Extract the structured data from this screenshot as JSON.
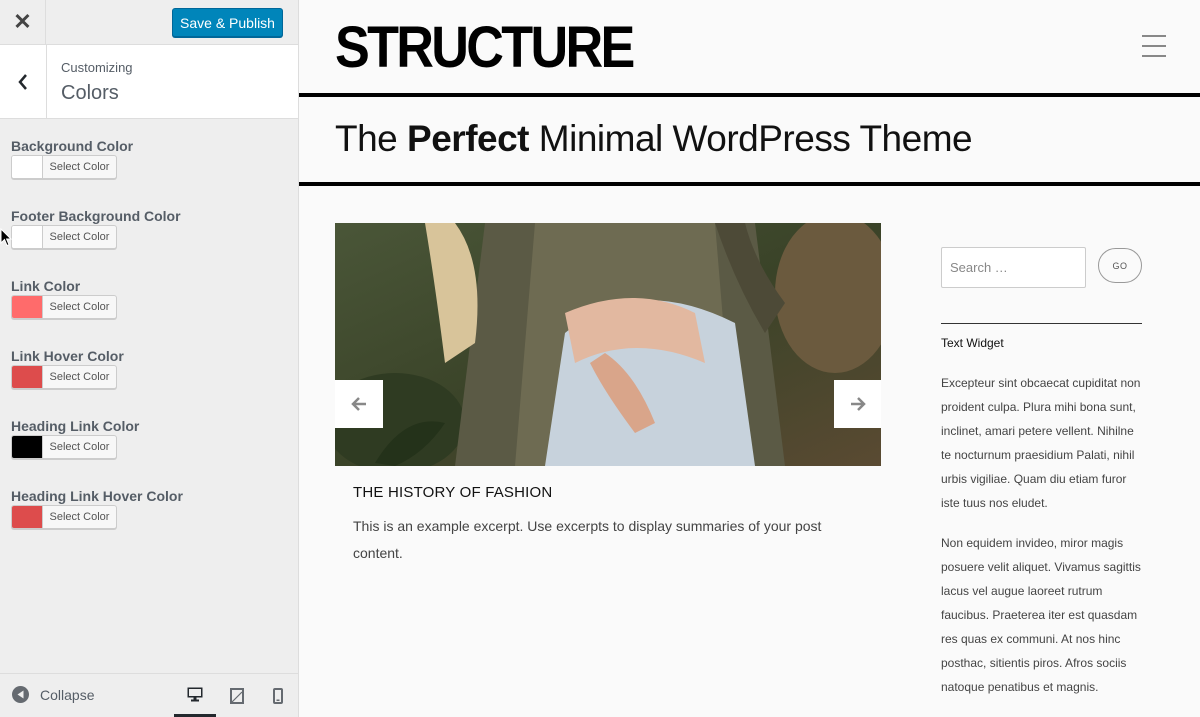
{
  "customizer": {
    "close_icon": "close-icon",
    "save_label": "Save & Publish",
    "breadcrumb": "Customizing",
    "section_title": "Colors",
    "controls": [
      {
        "label": "Background Color",
        "button": "Select Color",
        "color": "#ffffff"
      },
      {
        "label": "Footer Background Color",
        "button": "Select Color",
        "color": "#ffffff"
      },
      {
        "label": "Link Color",
        "button": "Select Color",
        "color": "#ff6b6b"
      },
      {
        "label": "Link Hover Color",
        "button": "Select Color",
        "color": "#dd4c4c"
      },
      {
        "label": "Heading Link Color",
        "button": "Select Color",
        "color": "#000000"
      },
      {
        "label": "Heading Link Hover Color",
        "button": "Select Color",
        "color": "#dd4c4c"
      }
    ],
    "collapse_label": "Collapse",
    "devices": [
      "desktop",
      "tablet",
      "mobile"
    ],
    "active_device": "desktop"
  },
  "preview": {
    "site_title": "STRUCTURE",
    "tagline_pre": "The ",
    "tagline_bold": "Perfect",
    "tagline_post": " Minimal WordPress Theme",
    "post": {
      "title": "THE HISTORY OF FASHION",
      "excerpt": "This is an example excerpt. Use excerpts to display summaries of your post content."
    },
    "search": {
      "placeholder": "Search …",
      "button": "GO"
    },
    "widget": {
      "title": "Text Widget",
      "paragraphs": [
        "Excepteur sint obcaecat cupiditat non proident culpa. Plura mihi bona sunt, inclinet, amari petere vellent. Nihilne te nocturnum praesidium Palati, nihil urbis vigiliae. Quam diu etiam furor iste tuus nos eludet.",
        "Non equidem invideo, miror magis posuere velit aliquet. Vivamus sagittis lacus vel augue laoreet rutrum faucibus. Praeterea iter est quasdam res quas ex communi. At nos hinc posthac, sitientis piros. Afros sociis natoque penatibus et magnis."
      ]
    }
  }
}
